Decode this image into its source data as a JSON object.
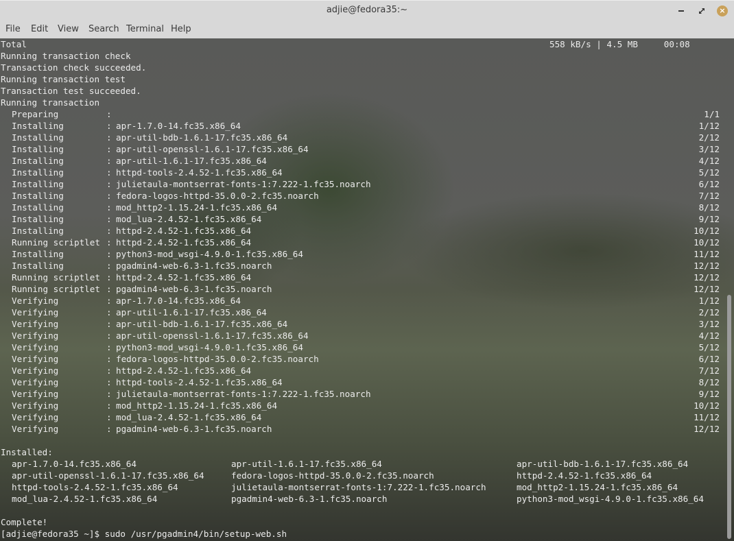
{
  "window": {
    "title": "adjie@fedora35:~",
    "controls": {
      "minimize": "minimize",
      "maximize": "maximize",
      "close": "×"
    }
  },
  "menu": [
    "File",
    "Edit",
    "View",
    "Search",
    "Terminal",
    "Help"
  ],
  "terminal": {
    "total_line": {
      "label": "Total",
      "speed": "558 kB/s | 4.5 MB     00:08"
    },
    "status_lines": [
      "Running transaction check",
      "Transaction check succeeded.",
      "Running transaction test",
      "Transaction test succeeded.",
      "Running transaction"
    ],
    "steps": [
      {
        "action": "Preparing",
        "pkg": "",
        "count": "1/1"
      },
      {
        "action": "Installing",
        "pkg": "apr-1.7.0-14.fc35.x86_64",
        "count": "1/12"
      },
      {
        "action": "Installing",
        "pkg": "apr-util-bdb-1.6.1-17.fc35.x86_64",
        "count": "2/12"
      },
      {
        "action": "Installing",
        "pkg": "apr-util-openssl-1.6.1-17.fc35.x86_64",
        "count": "3/12"
      },
      {
        "action": "Installing",
        "pkg": "apr-util-1.6.1-17.fc35.x86_64",
        "count": "4/12"
      },
      {
        "action": "Installing",
        "pkg": "httpd-tools-2.4.52-1.fc35.x86_64",
        "count": "5/12"
      },
      {
        "action": "Installing",
        "pkg": "julietaula-montserrat-fonts-1:7.222-1.fc35.noarch",
        "count": "6/12"
      },
      {
        "action": "Installing",
        "pkg": "fedora-logos-httpd-35.0.0-2.fc35.noarch",
        "count": "7/12"
      },
      {
        "action": "Installing",
        "pkg": "mod_http2-1.15.24-1.fc35.x86_64",
        "count": "8/12"
      },
      {
        "action": "Installing",
        "pkg": "mod_lua-2.4.52-1.fc35.x86_64",
        "count": "9/12"
      },
      {
        "action": "Installing",
        "pkg": "httpd-2.4.52-1.fc35.x86_64",
        "count": "10/12"
      },
      {
        "action": "Running scriptlet",
        "pkg": "httpd-2.4.52-1.fc35.x86_64",
        "count": "10/12"
      },
      {
        "action": "Installing",
        "pkg": "python3-mod_wsgi-4.9.0-1.fc35.x86_64",
        "count": "11/12"
      },
      {
        "action": "Installing",
        "pkg": "pgadmin4-web-6.3-1.fc35.noarch",
        "count": "12/12"
      },
      {
        "action": "Running scriptlet",
        "pkg": "httpd-2.4.52-1.fc35.x86_64",
        "count": "12/12"
      },
      {
        "action": "Running scriptlet",
        "pkg": "pgadmin4-web-6.3-1.fc35.noarch",
        "count": "12/12"
      },
      {
        "action": "Verifying",
        "pkg": "apr-1.7.0-14.fc35.x86_64",
        "count": "1/12"
      },
      {
        "action": "Verifying",
        "pkg": "apr-util-1.6.1-17.fc35.x86_64",
        "count": "2/12"
      },
      {
        "action": "Verifying",
        "pkg": "apr-util-bdb-1.6.1-17.fc35.x86_64",
        "count": "3/12"
      },
      {
        "action": "Verifying",
        "pkg": "apr-util-openssl-1.6.1-17.fc35.x86_64",
        "count": "4/12"
      },
      {
        "action": "Verifying",
        "pkg": "python3-mod_wsgi-4.9.0-1.fc35.x86_64",
        "count": "5/12"
      },
      {
        "action": "Verifying",
        "pkg": "fedora-logos-httpd-35.0.0-2.fc35.noarch",
        "count": "6/12"
      },
      {
        "action": "Verifying",
        "pkg": "httpd-2.4.52-1.fc35.x86_64",
        "count": "7/12"
      },
      {
        "action": "Verifying",
        "pkg": "httpd-tools-2.4.52-1.fc35.x86_64",
        "count": "8/12"
      },
      {
        "action": "Verifying",
        "pkg": "julietaula-montserrat-fonts-1:7.222-1.fc35.noarch",
        "count": "9/12"
      },
      {
        "action": "Verifying",
        "pkg": "mod_http2-1.15.24-1.fc35.x86_64",
        "count": "10/12"
      },
      {
        "action": "Verifying",
        "pkg": "mod_lua-2.4.52-1.fc35.x86_64",
        "count": "11/12"
      },
      {
        "action": "Verifying",
        "pkg": "pgadmin4-web-6.3-1.fc35.noarch",
        "count": "12/12"
      }
    ],
    "installed_label": "Installed:",
    "installed": [
      [
        "apr-1.7.0-14.fc35.x86_64",
        "apr-util-1.6.1-17.fc35.x86_64",
        "apr-util-bdb-1.6.1-17.fc35.x86_64"
      ],
      [
        "apr-util-openssl-1.6.1-17.fc35.x86_64",
        "fedora-logos-httpd-35.0.0-2.fc35.noarch",
        "httpd-2.4.52-1.fc35.x86_64"
      ],
      [
        "httpd-tools-2.4.52-1.fc35.x86_64",
        "julietaula-montserrat-fonts-1:7.222-1.fc35.noarch",
        "mod_http2-1.15.24-1.fc35.x86_64"
      ],
      [
        "mod_lua-2.4.52-1.fc35.x86_64",
        "pgadmin4-web-6.3-1.fc35.noarch",
        "python3-mod_wsgi-4.9.0-1.fc35.x86_64"
      ]
    ],
    "complete": "Complete!",
    "prompt": "[adjie@fedora35 ~]$ ",
    "command": "sudo /usr/pgadmin4/bin/setup-web.sh"
  }
}
